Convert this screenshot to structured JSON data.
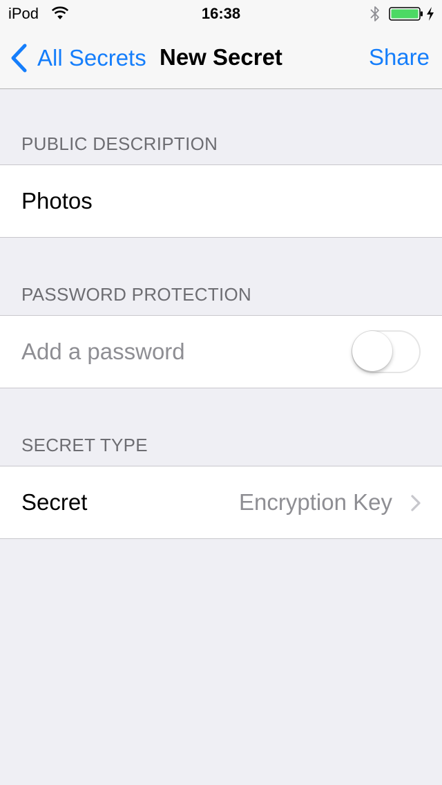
{
  "status_bar": {
    "carrier": "iPod",
    "time": "16:38",
    "battery_color": "#4cd964"
  },
  "nav": {
    "back_label": "All Secrets",
    "title": "New Secret",
    "share_label": "Share",
    "accent_color": "#157efb"
  },
  "sections": {
    "public_description": {
      "header": "PUBLIC DESCRIPTION",
      "value": "Photos"
    },
    "password_protection": {
      "header": "PASSWORD PROTECTION",
      "placeholder": "Add a password",
      "toggle_on": false
    },
    "secret_type": {
      "header": "SECRET TYPE",
      "label": "Secret",
      "value": "Encryption Key"
    }
  },
  "icons": [
    "wifi-icon",
    "bluetooth-icon",
    "battery-icon",
    "charging-bolt-icon",
    "back-chevron-icon",
    "disclosure-chevron-icon"
  ]
}
